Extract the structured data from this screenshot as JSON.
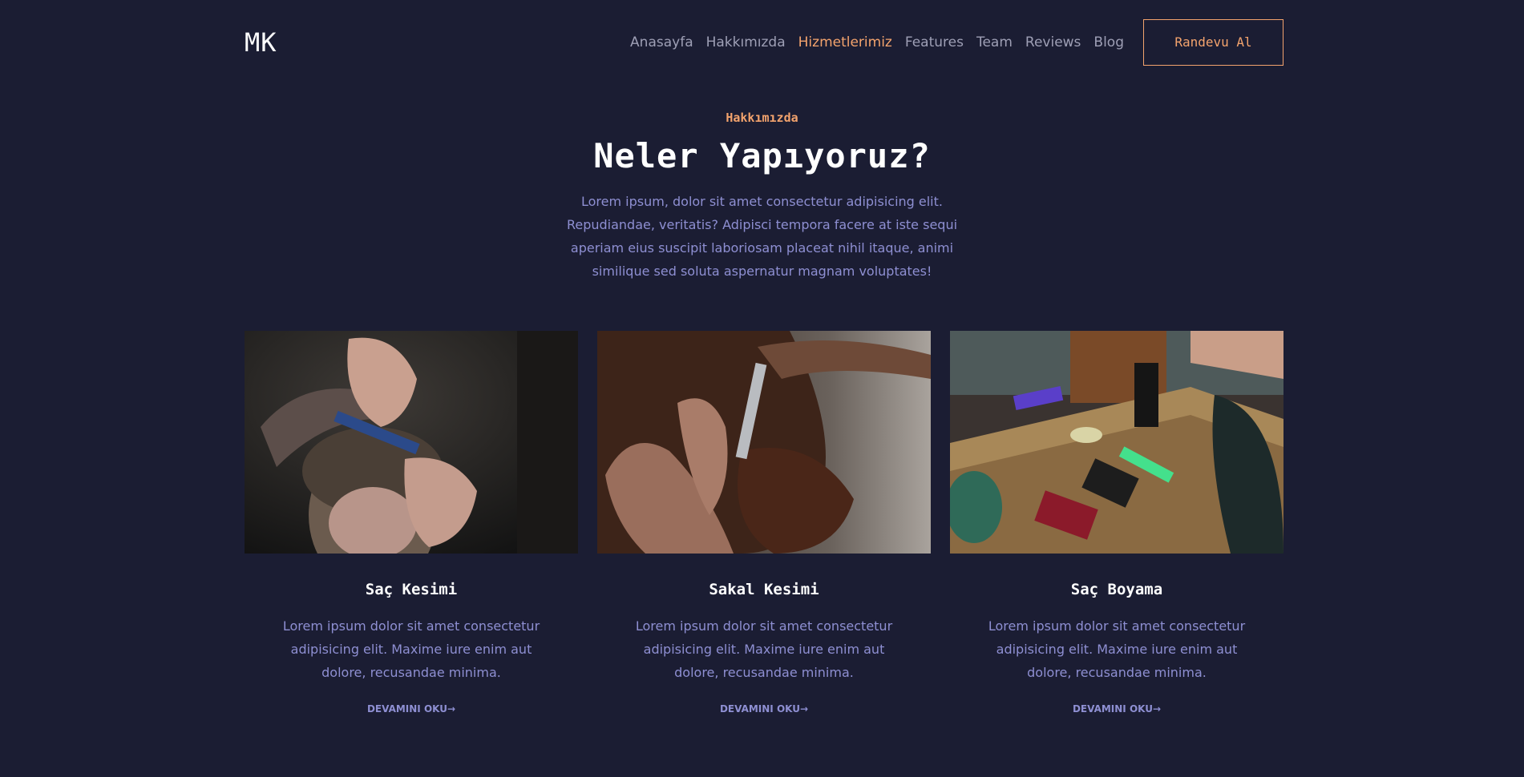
{
  "header": {
    "logo": "MK",
    "nav": [
      {
        "label": "Anasayfa",
        "active": false
      },
      {
        "label": "Hakkımızda",
        "active": false
      },
      {
        "label": "Hizmetlerimiz",
        "active": true
      },
      {
        "label": "Features",
        "active": false
      },
      {
        "label": "Team",
        "active": false
      },
      {
        "label": "Reviews",
        "active": false
      },
      {
        "label": "Blog",
        "active": false
      }
    ],
    "cta_label": "Randevu Al"
  },
  "intro": {
    "eyebrow": "Hakkımızda",
    "title": "Neler Yapıyoruz?",
    "text": "Lorem ipsum, dolor sit amet consectetur adipisicing elit. Repudiandae, veritatis? Adipisci tempora facere at iste sequi aperiam eius suscipit laboriosam placeat nihil itaque, animi similique sed soluta aspernatur magnam voluptates!"
  },
  "cards": [
    {
      "title": "Saç Kesimi",
      "text": "Lorem ipsum dolor sit amet consectetur adipisicing elit. Maxime iure enim aut dolore, recusandae minima.",
      "link": "DEVAMINI OKU",
      "image": "haircut-photo"
    },
    {
      "title": "Sakal Kesimi",
      "text": "Lorem ipsum dolor sit amet consectetur adipisicing elit. Maxime iure enim aut dolore, recusandae minima.",
      "link": "DEVAMINI OKU",
      "image": "beard-trim-photo"
    },
    {
      "title": "Saç Boyama",
      "text": "Lorem ipsum dolor sit amet consectetur adipisicing elit. Maxime iure enim aut dolore, recusandae minima.",
      "link": "DEVAMINI OKU",
      "image": "barber-tools-photo"
    }
  ],
  "colors": {
    "background": "#1b1d33",
    "accent": "#f3a36d",
    "body_text": "#8e8fd2",
    "nav_text": "#9e9fb5"
  }
}
